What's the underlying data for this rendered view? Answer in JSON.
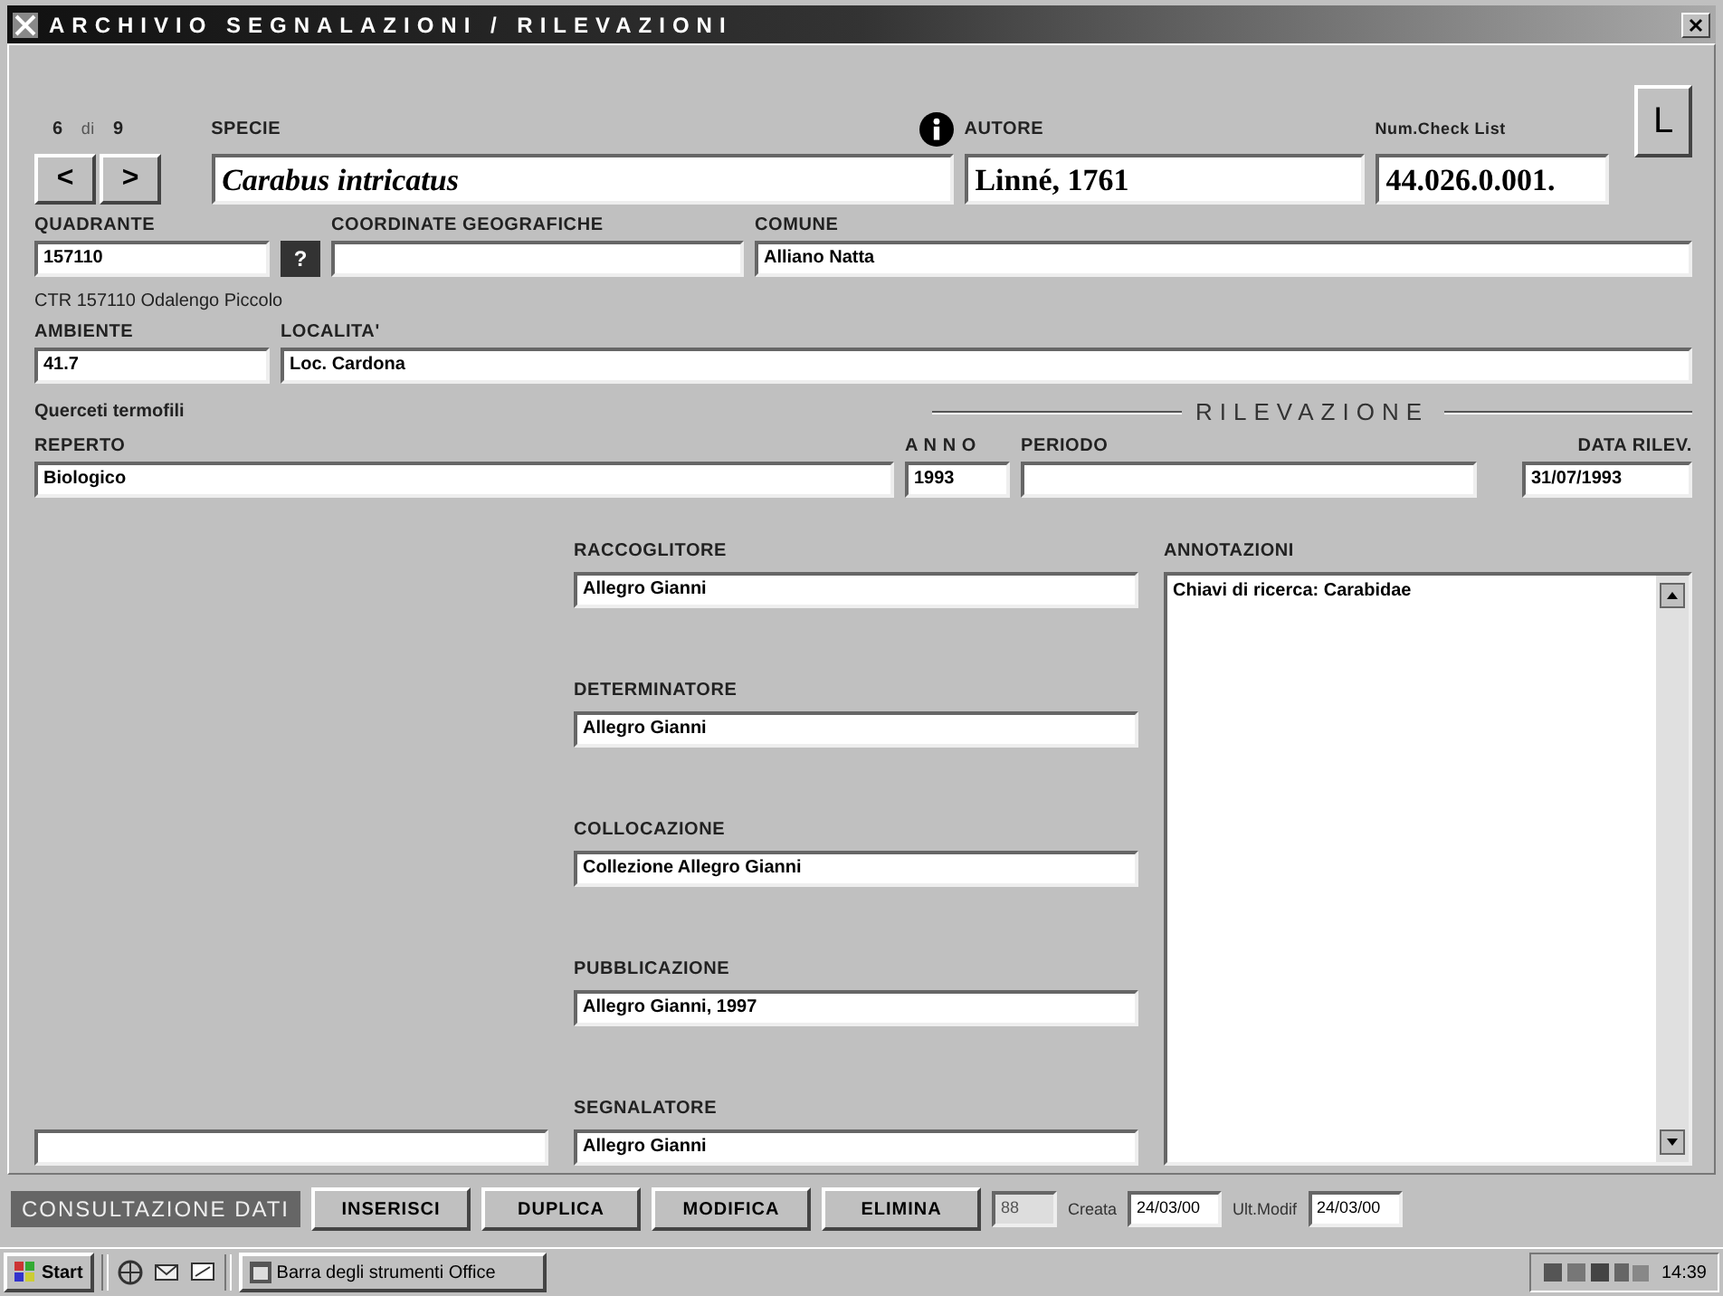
{
  "window": {
    "title": "ARCHIVIO SEGNALAZIONI / RILEVAZIONI"
  },
  "record": {
    "current": "6",
    "separator": "di",
    "total": "9",
    "nav_buttons": [
      "<",
      ">"
    ]
  },
  "species": {
    "label": "SPECIE",
    "value": "Carabus intricatus"
  },
  "author": {
    "label": "AUTORE",
    "value": "Linné, 1761"
  },
  "check_list": {
    "label": "Num.Check List",
    "value": "44.026.0.001."
  },
  "l_button": "L",
  "quadrant": {
    "label": "QUADRANTE",
    "value": "157110"
  },
  "help_button": "?",
  "coordinates": {
    "label": "COORDINATE GEOGRAFICHE"
  },
  "comune": {
    "label": "COMUNE",
    "value": "Alliano Natta"
  },
  "ctr_note": "CTR 157110 Odalengo Piccolo",
  "environment": {
    "label": "AMBIENTE",
    "value": "41.7"
  },
  "locality": {
    "label": "LOCALITA'",
    "value": "Loc. Cardona"
  },
  "habitat_note": "Querceti termofili",
  "section_title": "RILEVAZIONE",
  "specimen": {
    "label": "REPERTO",
    "value": "Biologico"
  },
  "year": {
    "label": "A N N O",
    "value": "1993"
  },
  "period": {
    "label": "PERIODO"
  },
  "survey_date": {
    "label": "DATA RILEV.",
    "value": "31/07/1993"
  },
  "people": [
    {
      "label": "RACCOGLITORE",
      "value": "Allegro Gianni"
    },
    {
      "label": "DETERMINATORE",
      "value": "Allegro Gianni"
    },
    {
      "label": "COLLOCAZIONE",
      "value": "Collezione Allegro Gianni"
    },
    {
      "label": "PUBBLICAZIONE",
      "value": "Allegro Gianni, 1997"
    },
    {
      "label": "SEGNALATORE",
      "value": "Allegro Gianni"
    }
  ],
  "notes": {
    "label": "ANNOTAZIONI",
    "value": "Chiavi di ricerca: Carabidae"
  },
  "toolbar": {
    "mode": "CONSULTAZIONE DATI",
    "buttons": [
      "INSERISCI",
      "DUPLICA",
      "MODIFICA",
      "ELIMINA"
    ],
    "record_id": "88",
    "created_label": "Creata",
    "created": "24/03/00",
    "modified_label": "Ult.Modif",
    "modified": "24/03/00"
  },
  "taskbar": {
    "start": "Start",
    "task": "Barra degli strumenti Office",
    "clock": "14:39"
  }
}
